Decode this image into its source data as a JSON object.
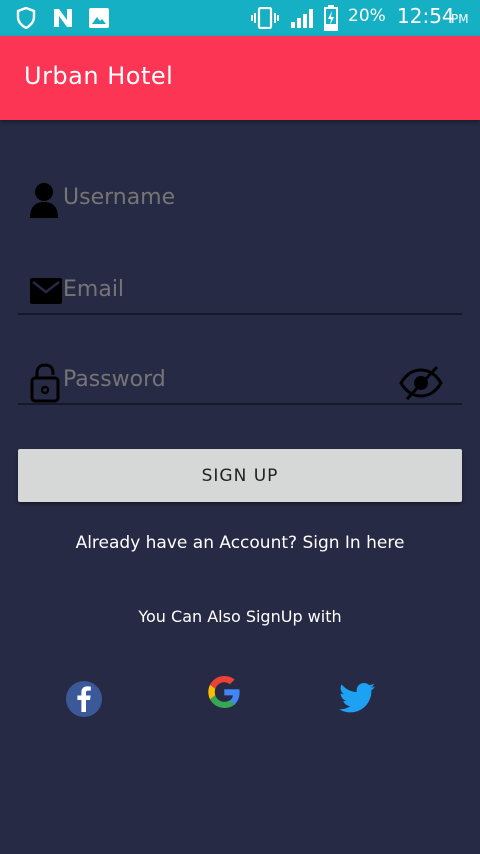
{
  "status_bar": {
    "battery": "20%",
    "time": "12:54",
    "ampm": "PM",
    "icons": [
      "shield-icon",
      "n-app-icon",
      "gallery-icon",
      "vibrate-icon",
      "signal-icon",
      "battery-charging-icon"
    ]
  },
  "app_bar": {
    "title": "Urban Hotel",
    "color": "#fd3555"
  },
  "form": {
    "username_placeholder": "Username",
    "email_placeholder": "Email",
    "password_placeholder": "Password",
    "signup_label": "SIGN UP"
  },
  "links": {
    "sign_in_text": "Already have an Account? Sign In here",
    "also_signup_text": "You Can Also SignUp with"
  },
  "social": [
    "facebook-icon",
    "google-icon",
    "twitter-icon"
  ],
  "colors": {
    "background": "#262a45",
    "status_bar": "#16b0c4",
    "button": "#d6d7d7"
  }
}
